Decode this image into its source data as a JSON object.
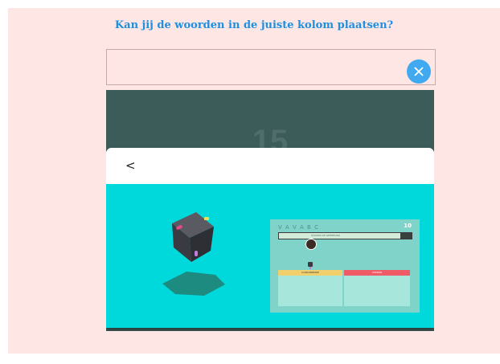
{
  "page": {
    "title": "Kan jij de woorden in de juiste kolom plaatsen?"
  },
  "toolbar": {
    "close_icon": "close-icon"
  },
  "game": {
    "background_number": "15"
  },
  "modal": {
    "back_label": "<"
  },
  "preview": {
    "title": "V A V A B C",
    "count": "10",
    "progress_label": "STATION OP GEHEELING",
    "column_left": "CONSUMENDE",
    "column_right": "VERDER",
    "progress": 0.92
  },
  "colors": {
    "title": "#1f8fe0",
    "close_button": "#40a9ef",
    "modal_body": "#00d9dc",
    "game_background": "#3c5c59",
    "column_left_header": "#f1cf6a",
    "column_right_header": "#ef5a66"
  }
}
